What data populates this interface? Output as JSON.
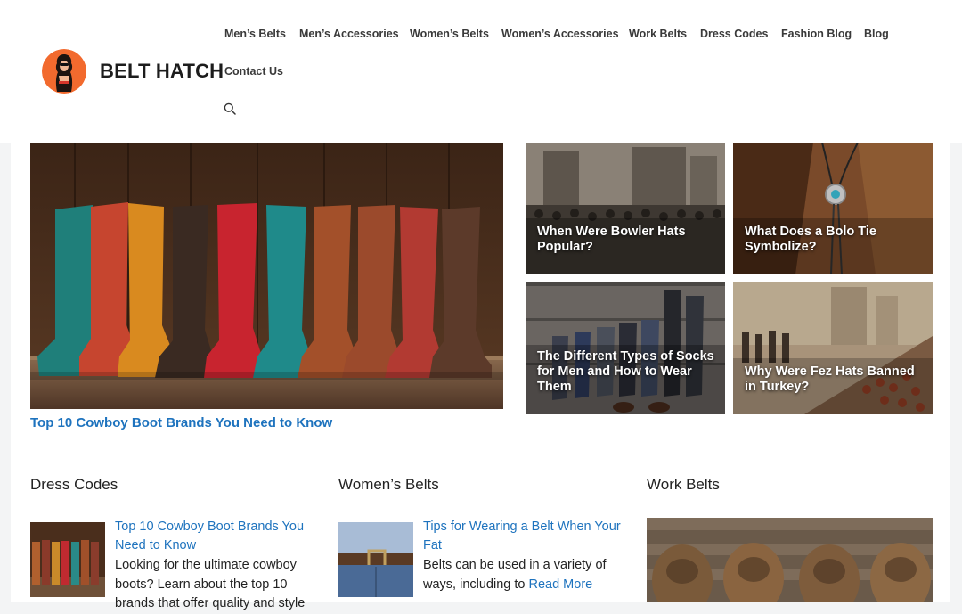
{
  "site": {
    "title": "BELT HATCH"
  },
  "nav": {
    "items": [
      {
        "label": "Men’s Belts"
      },
      {
        "label": "Men’s Accessories"
      },
      {
        "label": "Women’s Belts"
      },
      {
        "label": "Women’s Accessories"
      },
      {
        "label": "Work Belts"
      },
      {
        "label": "Dress Codes"
      },
      {
        "label": "Fashion Blog"
      },
      {
        "label": "Blog"
      },
      {
        "label": "Contact Us"
      }
    ],
    "search_icon": "search-icon"
  },
  "featured": {
    "title": "Top 10 Cowboy Boot Brands You Need to Know"
  },
  "tiles": [
    {
      "title": "When Were Bowler Hats Popular?"
    },
    {
      "title": "What Does a Bolo Tie Symbolize?"
    },
    {
      "title": "The Different Types of Socks for Men and How to Wear Them"
    },
    {
      "title": "Why Were Fez Hats Banned in Turkey?"
    }
  ],
  "sections": [
    {
      "heading": "Dress Codes",
      "post": {
        "title": "Top 10 Cowboy Boot Brands You Need to Know",
        "excerpt": "Looking for the ultimate cowboy boots? Learn about the top 10 brands that offer quality and style"
      }
    },
    {
      "heading": "Women’s Belts",
      "post": {
        "title": "Tips for Wearing a Belt When Your Fat",
        "excerpt": "Belts can be used in a variety of ways, including to",
        "read_more": "Read More"
      }
    },
    {
      "heading": "Work Belts"
    }
  ],
  "colors": {
    "link": "#1e73be",
    "logo_bg": "#f26a2e",
    "text": "#222222"
  }
}
